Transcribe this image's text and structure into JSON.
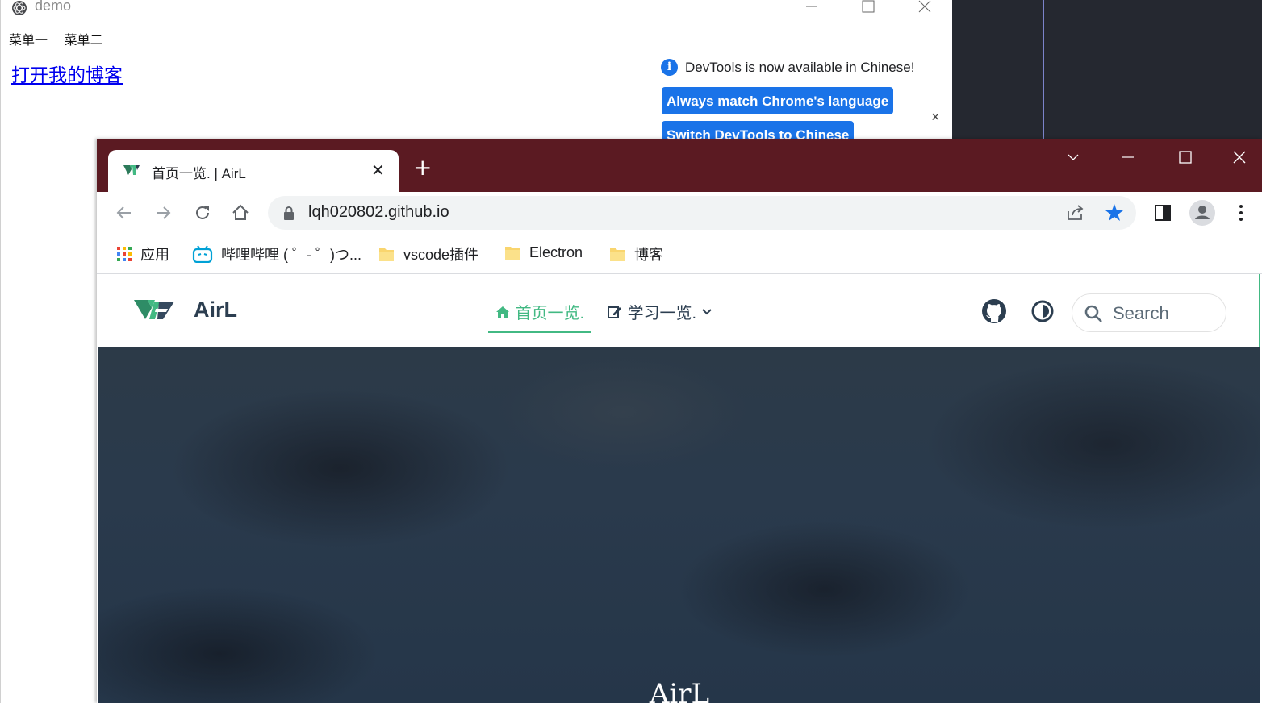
{
  "electron_window": {
    "title": "demo",
    "menu": [
      "菜单一",
      "菜单二"
    ],
    "link_text": "打开我的博客"
  },
  "devtools_notice": {
    "message": "DevTools is now available in Chinese!",
    "button_match": "Always match Chrome's language",
    "button_switch": "Switch DevTools to Chinese",
    "close": "×"
  },
  "chrome": {
    "tab_title": "首页一览. | AirL",
    "tab_close": "✕",
    "new_tab": "+",
    "url": "lqh020802.github.io",
    "frame_color": "#5b1a22",
    "bookmarks": [
      {
        "label": "应用",
        "icon": "apps-grid-icon"
      },
      {
        "label": "哔哩哔哩 ( ゜- ゜)つ...",
        "icon": "bilibili-icon"
      },
      {
        "label": "vscode插件",
        "icon": "folder-icon"
      },
      {
        "label": "Electron",
        "icon": "folder-icon"
      },
      {
        "label": "博客",
        "icon": "folder-icon"
      }
    ]
  },
  "site": {
    "name": "AirL",
    "nav_home": "首页一览.",
    "nav_study": "学习一览.",
    "search_placeholder": "Search",
    "hero_title": "AirL",
    "accent_color": "#42b983"
  }
}
